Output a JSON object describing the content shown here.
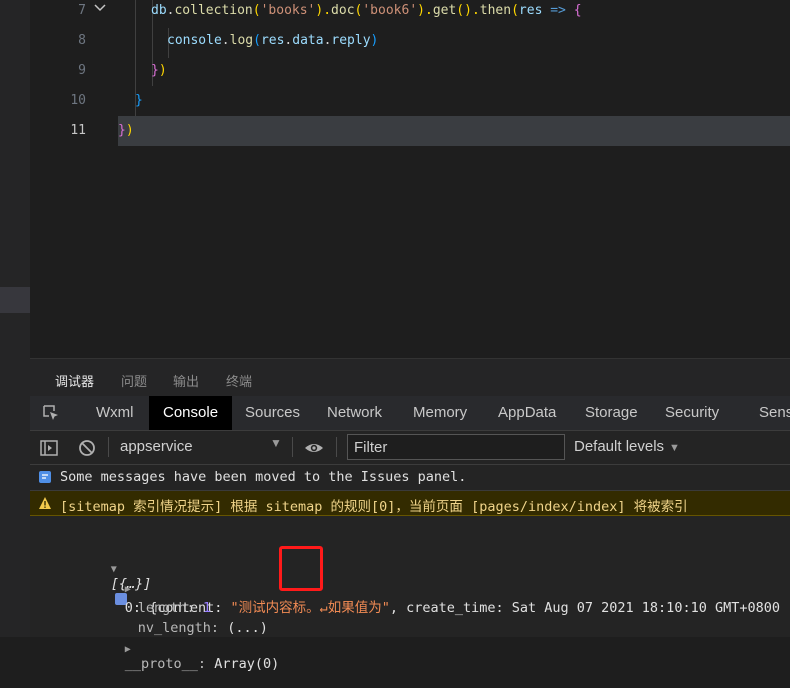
{
  "editor": {
    "line_numbers": [
      "7",
      "8",
      "9",
      "10",
      "11"
    ],
    "lines": {
      "l7": {
        "a": "db",
        "b": ".",
        "c": "collection",
        "d": "(",
        "e": "'books'",
        "f": ").",
        "g": "doc",
        "h": "(",
        "i": "'book6'",
        "j": ").",
        "k": "get",
        "l": "().",
        "m": "then",
        "n": "(",
        "o": "res",
        "p": " ",
        "q": "=>",
        "r": " {"
      },
      "l8": {
        "a": "console",
        "b": ".",
        "c": "log",
        "d": "(",
        "e": "res",
        "f": ".",
        "g": "data",
        "h": ".",
        "i": "reply",
        "j": ")"
      },
      "l9": {
        "a": "}",
        "b": ")"
      },
      "l10": {
        "a": "}"
      },
      "l11": {
        "a": "}",
        "b": ")"
      }
    }
  },
  "panel_tabs": [
    "调试器",
    "问题",
    "输出",
    "终端"
  ],
  "devtools": {
    "tabs": [
      "Wxml",
      "Console",
      "Sources",
      "Network",
      "Memory",
      "AppData",
      "Storage",
      "Security",
      "Sens"
    ],
    "active_tab": "Console",
    "context": "appservice",
    "filter_placeholder": "Filter",
    "levels": "Default levels",
    "messages": {
      "info": "Some messages have been moved to the Issues panel.",
      "warn": "[sitemap 索引情况提示] 根据 sitemap 的规则[0]，当前页面 [pages/index/index] 将被索引"
    },
    "object": {
      "summary": "[{…}]",
      "row0_key": "0:",
      "row0_open": " {content: ",
      "row0_content": "\"测试内容标。↵如果值为\"",
      "row0_rest": ", create_time: Sat Aug 07 2021 18:10:10 GMT+0800 (",
      "length_key": "length:",
      "length_val": "1",
      "nv_key": "nv_length:",
      "nv_val": "(...)",
      "proto_key": "__proto__:",
      "proto_val": "Array(0)"
    }
  },
  "colors": {
    "highlight_box": "#ff1a1a",
    "warning_bg": "#332b00",
    "active_tab_bg": "#000000"
  }
}
